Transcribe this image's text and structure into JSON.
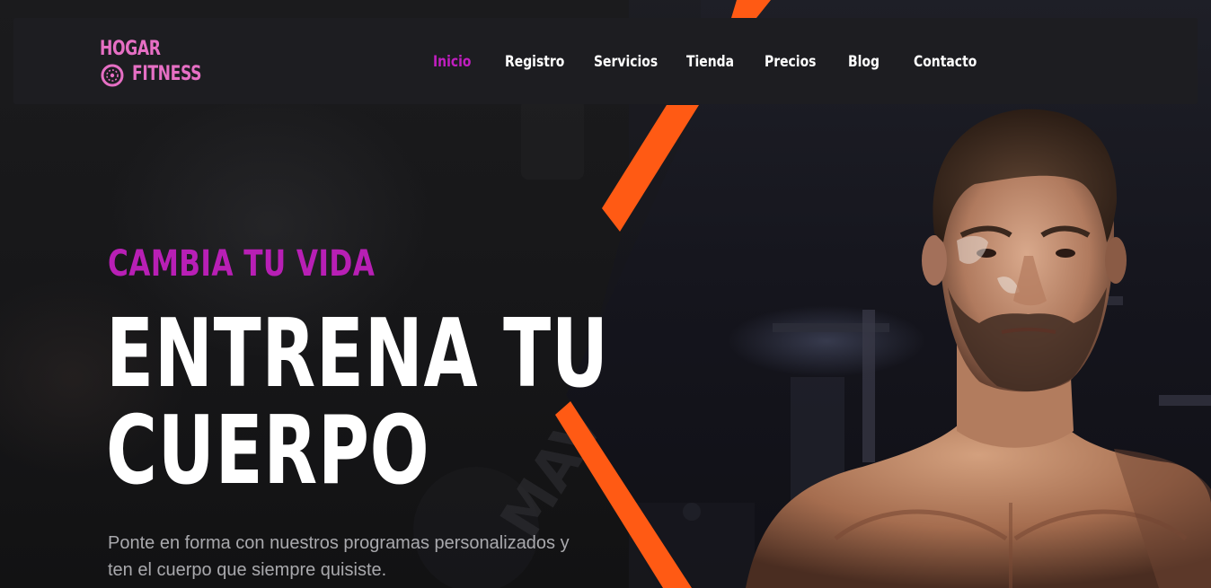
{
  "brand": {
    "line1": "HOGAR",
    "line2": "FITNESS",
    "color": "#e66fc4"
  },
  "nav": {
    "items": [
      {
        "label": "Inicio",
        "active": true
      },
      {
        "label": "Registro",
        "active": false
      },
      {
        "label": "Servicios",
        "active": false
      },
      {
        "label": "Tienda",
        "active": false
      },
      {
        "label": "Precios",
        "active": false
      },
      {
        "label": "Blog",
        "active": false
      },
      {
        "label": "Contacto",
        "active": false
      }
    ],
    "active_color": "#c11ec0"
  },
  "hero": {
    "kicker": "CAMBIA TU VIDA",
    "headline_line1": "ENTRENA TU",
    "headline_line2": "CUERPO",
    "subtext_line1": "Ponte en forma con nuestros programas personalizados y",
    "subtext_line2": "ten el cuerpo que siempre quisiste.",
    "accent_color": "#ff5a14",
    "kicker_color": "#b81fb5"
  },
  "icons": {
    "logo_disc": "weight-plate-icon"
  }
}
